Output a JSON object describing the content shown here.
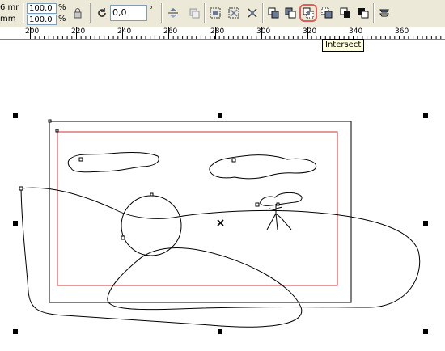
{
  "toolbar": {
    "width_fragment": "6 mr",
    "height_fragment": "mm",
    "scale_x": "100.0",
    "scale_y": "100.0",
    "percent_x": "%",
    "percent_y": "%",
    "rotation_value": "0,0",
    "degree_symbol": "°"
  },
  "tooltip": {
    "text": "Intersect"
  },
  "ruler": {
    "labels": [
      "200",
      "220",
      "240",
      "260",
      "280",
      "300",
      "320",
      "340",
      "360"
    ]
  },
  "colors": {
    "highlight": "#e45b5b",
    "red_frame": "#d0303a",
    "tooltip_bg": "#ffffe1"
  },
  "icons": [
    "lock-ratio-icon",
    "rotate-icon",
    "mirror-icon",
    "group-icon",
    "ungroup-icon",
    "ungroup-all-icon",
    "combine-icon",
    "weld-icon",
    "intersect-icon",
    "simplify-icon",
    "front-minus-back-icon",
    "back-minus-front-icon",
    "create-boundary-icon"
  ]
}
